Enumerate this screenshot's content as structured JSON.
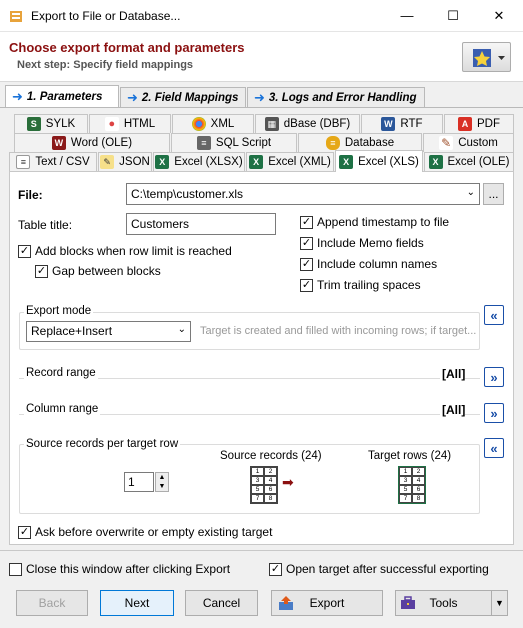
{
  "window": {
    "title": "Export to File or Database...",
    "minimize": "—",
    "maximize": "☐",
    "close": "✕"
  },
  "header": {
    "title": "Choose export format and parameters",
    "subtitle": "Next step: Specify field mappings"
  },
  "main_tabs": [
    {
      "label": "1. Parameters"
    },
    {
      "label": "2. Field Mappings"
    },
    {
      "label": "3. Logs and Error Handling"
    }
  ],
  "format_tabs_row1": [
    {
      "label": "SYLK",
      "icon": "sylk-icon"
    },
    {
      "label": "HTML",
      "icon": "html-icon"
    },
    {
      "label": "XML",
      "icon": "xml-icon"
    },
    {
      "label": "dBase (DBF)",
      "icon": "dbase-icon"
    },
    {
      "label": "RTF",
      "icon": "rtf-icon"
    },
    {
      "label": "PDF",
      "icon": "pdf-icon"
    }
  ],
  "format_tabs_row2": [
    {
      "label": "Word (OLE)",
      "icon": "word-icon"
    },
    {
      "label": "SQL Script",
      "icon": "sql-icon"
    },
    {
      "label": "Database",
      "icon": "database-icon"
    },
    {
      "label": "Custom",
      "icon": "custom-icon"
    }
  ],
  "format_tabs_row3": [
    {
      "label": "Text / CSV",
      "icon": "text-icon"
    },
    {
      "label": "JSON",
      "icon": "json-icon"
    },
    {
      "label": "Excel (XLSX)",
      "icon": "excel-icon"
    },
    {
      "label": "Excel (XML)",
      "icon": "excel-icon"
    },
    {
      "label": "Excel (XLS)",
      "icon": "excel-icon"
    },
    {
      "label": "Excel (OLE)",
      "icon": "excel-icon"
    }
  ],
  "form": {
    "file_label": "File:",
    "file_value": "C:\\temp\\customer.xls",
    "browse_label": "...",
    "table_title_label": "Table title:",
    "table_title_value": "Customers",
    "add_blocks_label": "Add blocks when row limit is reached",
    "gap_between_label": "Gap between blocks",
    "append_timestamp_label": "Append timestamp to file",
    "include_memo_label": "Include Memo fields",
    "include_colnames_label": "Include column names",
    "trim_spaces_label": "Trim trailing spaces",
    "export_mode_label": "Export mode",
    "export_mode_value": "Replace+Insert",
    "export_mode_desc": "Target is created and filled with incoming rows; if target...",
    "record_range_label": "Record range",
    "record_range_value": "[All]",
    "column_range_label": "Column range",
    "column_range_value": "[All]",
    "source_per_target_label": "Source records per target row",
    "source_per_target_value": "1",
    "source_records_label": "Source records (24)",
    "target_rows_label": "Target rows (24)",
    "grid_values": [
      "1",
      "2",
      "3",
      "4",
      "5",
      "6",
      "7",
      "8"
    ],
    "ask_overwrite_label": "Ask before overwrite or empty existing target"
  },
  "footer": {
    "close_window_label": "Close this window after clicking Export",
    "open_target_label": "Open target after successful exporting",
    "back_label": "Back",
    "next_label": "Next",
    "cancel_label": "Cancel",
    "export_label": "Export",
    "tools_label": "Tools"
  },
  "colors": {
    "header_title": "#8b1010",
    "accent_blue": "#1a73d9",
    "excel_green": "#1e7145"
  }
}
